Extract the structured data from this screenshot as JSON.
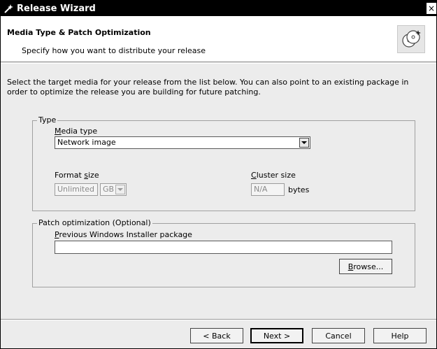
{
  "window": {
    "title": "Release Wizard",
    "close_glyph": "×"
  },
  "header": {
    "title": "Media Type & Patch Optimization",
    "subtitle": "Specify how you want to distribute your release",
    "icon": "media-discs-icon"
  },
  "intro_text": "Select the target media for your release from the list below. You can also point to an existing package in order to optimize the release you are building for future patching.",
  "type_group": {
    "legend": "Type",
    "media_type_label_mnemonic": "M",
    "media_type_label_rest": "edia type",
    "media_type_value": "Network image",
    "format_size_label_prefix": "Format ",
    "format_size_label_mnemonic": "s",
    "format_size_label_rest": "ize",
    "format_size_value": "Unlimited",
    "format_unit_value": "GB",
    "cluster_size_label_mnemonic": "C",
    "cluster_size_label_rest": "luster size",
    "cluster_size_value": "N/A",
    "cluster_unit": "bytes"
  },
  "patch_group": {
    "legend": "Patch optimization (Optional)",
    "prev_pkg_label_mnemonic": "P",
    "prev_pkg_label_rest": "revious Windows Installer package",
    "prev_pkg_value": "",
    "browse_label_mnemonic": "B",
    "browse_label_rest": "rowse..."
  },
  "footer": {
    "back_label": "< Back",
    "next_label": "Next >",
    "cancel_label": "Cancel",
    "help_label": "Help"
  }
}
